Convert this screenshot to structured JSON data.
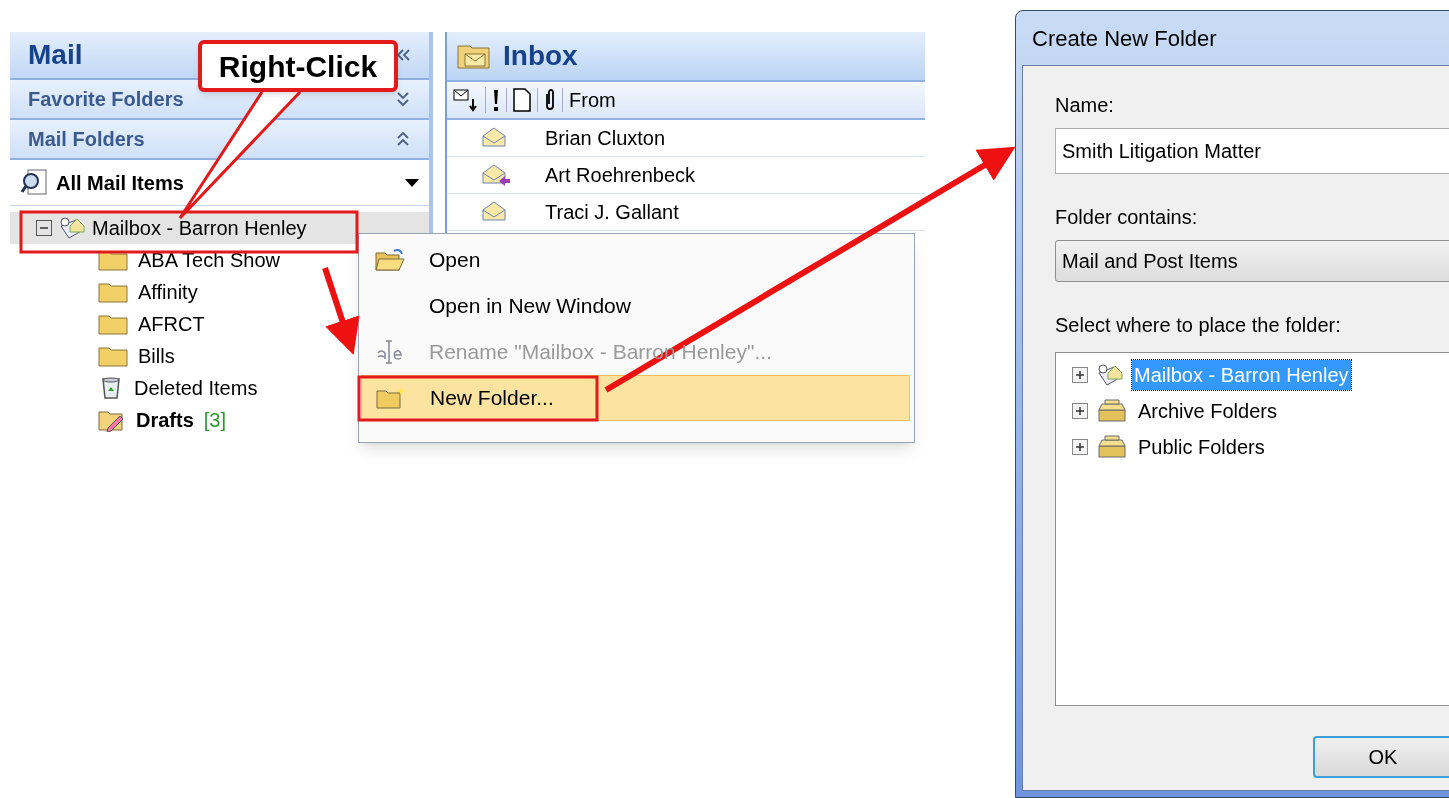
{
  "navigation_pane": {
    "title": "Mail",
    "sections": [
      {
        "label": "Favorite Folders",
        "expanded": false
      },
      {
        "label": "Mail Folders",
        "expanded": true
      }
    ],
    "view_selector": "All Mail Items",
    "tree": {
      "label": "Mailbox - Barron Henley",
      "selected": true,
      "expanded": true,
      "children": [
        {
          "kind": "folder",
          "label": "ABA Tech Show",
          "bold": false
        },
        {
          "kind": "folder",
          "label": "Affinity",
          "bold": false
        },
        {
          "kind": "folder",
          "label": "AFRCT",
          "bold": false
        },
        {
          "kind": "folder",
          "label": "Bills",
          "bold": false
        },
        {
          "kind": "trash",
          "label": "Deleted Items",
          "bold": false
        },
        {
          "kind": "drafts",
          "label": "Drafts",
          "bold": true,
          "count": "[3]"
        }
      ]
    }
  },
  "inbox": {
    "title": "Inbox",
    "columns": [
      "From"
    ],
    "rows": [
      {
        "kind": "read",
        "from": "Brian Cluxton"
      },
      {
        "kind": "replied",
        "from": "Art Roehrenbeck"
      },
      {
        "kind": "read",
        "from": "Traci J. Gallant"
      }
    ]
  },
  "context_menu": [
    {
      "kind": "open",
      "label": "Open",
      "disabled": false,
      "selected": false
    },
    {
      "kind": "none",
      "label": "Open in New Window",
      "disabled": false,
      "selected": false
    },
    {
      "kind": "rename",
      "label": "Rename \"Mailbox - Barron Henley\"...",
      "disabled": true,
      "selected": false
    },
    {
      "kind": "new",
      "label": "New Folder...",
      "disabled": false,
      "selected": true
    }
  ],
  "dialog": {
    "title": "Create New Folder",
    "name_label": "Name:",
    "name_value": "Smith Litigation Matter",
    "contains_label": "Folder contains:",
    "contains_value": "Mail and Post Items",
    "place_label": "Select where to place the folder:",
    "tree": [
      {
        "kind": "mailbox",
        "label": "Mailbox - Barron Henley",
        "selected": true
      },
      {
        "kind": "archive",
        "label": "Archive Folders",
        "selected": false
      },
      {
        "kind": "archive",
        "label": "Public Folders",
        "selected": false
      }
    ],
    "buttons": [
      "OK"
    ]
  },
  "annotation": {
    "callout": "Right-Click"
  }
}
